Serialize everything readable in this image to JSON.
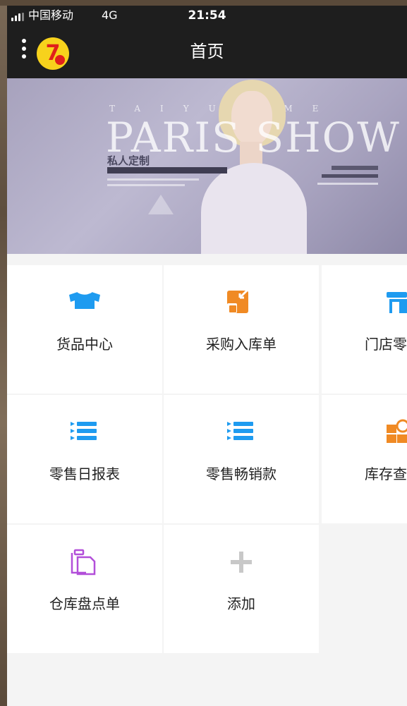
{
  "status": {
    "carrier": "中国移动",
    "network": "4G",
    "time": "21:54"
  },
  "nav": {
    "title": "首页",
    "logo_text": "7",
    "menu_icon": "more-vertical-icon"
  },
  "banner": {
    "big_text": "PARIS SHOW",
    "spaced_text": "TAIYUE ME",
    "cn_title": "私人定制"
  },
  "colors": {
    "nav_bg": "#1e1e1e",
    "blue": "#1e9bf0",
    "orange": "#f08a24",
    "purple": "#b24fd9",
    "gray": "#c8c8c8"
  },
  "menu": [
    {
      "label": "货品中心",
      "icon": "clothes-icon"
    },
    {
      "label": "采购入库单",
      "icon": "purchase-inbound-icon"
    },
    {
      "label": "门店零",
      "icon": "store-icon"
    },
    {
      "label": "零售日报表",
      "icon": "list-icon"
    },
    {
      "label": "零售畅销款",
      "icon": "list-icon"
    },
    {
      "label": "库存查",
      "icon": "inventory-icon"
    },
    {
      "label": "仓库盘点单",
      "icon": "clipboard-icon"
    },
    {
      "label": "添加",
      "icon": "plus-icon"
    }
  ]
}
